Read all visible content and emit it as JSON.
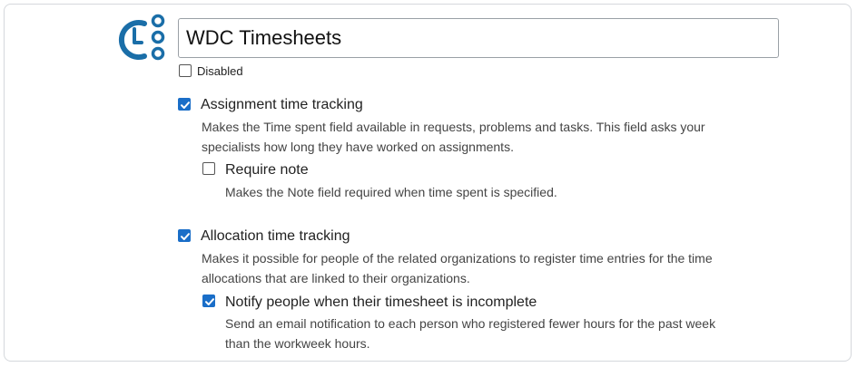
{
  "app": {
    "name_value": "WDC Timesheets",
    "logo_icon": "timesheet-clock-icon",
    "accent_color": "#1a6ea8"
  },
  "disabled": {
    "label": "Disabled",
    "checked": false
  },
  "assignment": {
    "label": "Assignment time tracking",
    "checked": true,
    "description_line1": "Makes the Time spent field available in requests, problems and tasks. This field asks your",
    "description_line2": "specialists how long they have worked on assignments.",
    "require_note": {
      "label": "Require note",
      "checked": false,
      "description": "Makes the Note field required when time spent is specified."
    }
  },
  "allocation": {
    "label": "Allocation time tracking",
    "checked": true,
    "description_line1": "Makes it possible for people of the related organizations to register time entries for the time",
    "description_line2": "allocations that are linked to their organizations.",
    "notify": {
      "label": "Notify people when their timesheet is incomplete",
      "checked": true,
      "description_line1": "Send an email notification to each person who registered fewer hours for the past week",
      "description_line2": "than the workweek hours."
    }
  }
}
